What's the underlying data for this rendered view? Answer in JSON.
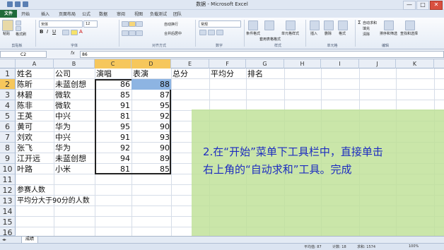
{
  "window": {
    "title": "数据 - Microsoft Excel",
    "minimize": "—",
    "maximize": "□",
    "close": "✕"
  },
  "tabs": [
    "文件",
    "开始",
    "插入",
    "页面布局",
    "公式",
    "数据",
    "审阅",
    "视图",
    "负载测试",
    "团队"
  ],
  "ribbon": {
    "clipboard": {
      "paste": "粘贴",
      "format_painter": "格式刷",
      "label": "剪贴板"
    },
    "font": {
      "name": "宋体",
      "size": "12",
      "label": "字体"
    },
    "alignment": {
      "wrap": "自动换行",
      "merge": "合并后居中",
      "label": "对齐方式"
    },
    "number": {
      "format": "常规",
      "label": "数字"
    },
    "styles": {
      "conditional": "条件格式",
      "table": "套用表格格式",
      "cell": "单元格样式",
      "label": "样式"
    },
    "cells": {
      "insert": "插入",
      "delete": "删除",
      "format": "格式",
      "label": "单元格"
    },
    "editing": {
      "autosum": "自动求和",
      "fill": "填充",
      "clear": "清除",
      "sort": "排序和筛选",
      "find": "查找和选择",
      "label": "编辑"
    }
  },
  "formula_bar": {
    "name_box": "C2",
    "fx": "fx",
    "value": "86"
  },
  "columns": [
    "A",
    "B",
    "C",
    "D",
    "E",
    "F",
    "G",
    "H",
    "I",
    "J",
    "K"
  ],
  "rows": [
    "1",
    "2",
    "3",
    "4",
    "5",
    "6",
    "7",
    "8",
    "9",
    "10",
    "11",
    "12",
    "13",
    "14",
    "15",
    "16"
  ],
  "headers": {
    "name": "姓名",
    "company": "公司",
    "sing": "演唱",
    "perform": "表演",
    "total": "总分",
    "avg": "平均分",
    "rank": "排名"
  },
  "table": [
    {
      "name": "陈昕",
      "company": "未蓝创想",
      "sing": "86",
      "perform": "88"
    },
    {
      "name": "林碧",
      "company": "微软",
      "sing": "85",
      "perform": "87"
    },
    {
      "name": "陈非",
      "company": "微软",
      "sing": "91",
      "perform": "95"
    },
    {
      "name": "王英",
      "company": "中兴",
      "sing": "81",
      "perform": "92"
    },
    {
      "name": "黄可",
      "company": "华为",
      "sing": "95",
      "perform": "90"
    },
    {
      "name": "刘欢",
      "company": "中兴",
      "sing": "91",
      "perform": "93"
    },
    {
      "name": "张飞",
      "company": "华为",
      "sing": "92",
      "perform": "90"
    },
    {
      "name": "江开远",
      "company": "未蓝创想",
      "sing": "94",
      "perform": "89"
    },
    {
      "name": "叶路",
      "company": "小米",
      "sing": "81",
      "perform": "85"
    }
  ],
  "extra": {
    "participants": "参赛人数",
    "above90": "平均分大于90分的人数"
  },
  "overlay": {
    "line1": "2.在“开始”菜单下工具栏中，直接单击",
    "line2": "右上角的“自动求和”工具。完成"
  },
  "sheet_tab": "成绩",
  "status": {
    "avg": "平均值: 87",
    "count": "计数: 18",
    "sum": "求和: 1574",
    "zoom": "100%"
  },
  "colors": {
    "selected_header": "#f6c75c",
    "selected_cell": "#8db4e2",
    "overlay_text": "#1d2cc0",
    "overlay_bg": "#bee196"
  }
}
